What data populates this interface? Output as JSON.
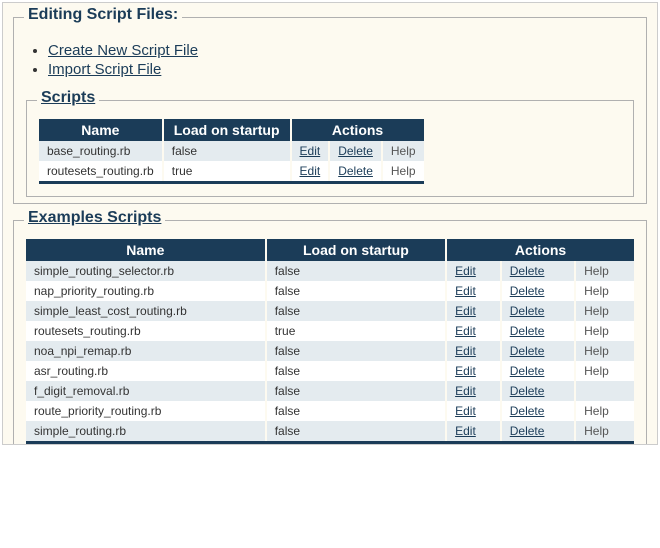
{
  "heading": "Editing Script Files:",
  "top_links": {
    "create": "Create New Script File",
    "import": "Import Script File"
  },
  "labels": {
    "edit": "Edit",
    "delete": "Delete",
    "help": "Help"
  },
  "scripts": {
    "title": "Scripts",
    "columns": {
      "name": "Name",
      "load": "Load on startup",
      "actions": "Actions"
    },
    "rows": [
      {
        "name": "base_routing.rb",
        "load": "false",
        "help": true
      },
      {
        "name": "routesets_routing.rb",
        "load": "true",
        "help": true
      }
    ]
  },
  "examples": {
    "title": "Examples Scripts",
    "columns": {
      "name": "Name",
      "load": "Load on startup",
      "actions": "Actions"
    },
    "rows": [
      {
        "name": "simple_routing_selector.rb",
        "load": "false",
        "help": true
      },
      {
        "name": "nap_priority_routing.rb",
        "load": "false",
        "help": true
      },
      {
        "name": "simple_least_cost_routing.rb",
        "load": "false",
        "help": true
      },
      {
        "name": "routesets_routing.rb",
        "load": "true",
        "help": true
      },
      {
        "name": "noa_npi_remap.rb",
        "load": "false",
        "help": true
      },
      {
        "name": "asr_routing.rb",
        "load": "false",
        "help": true
      },
      {
        "name": "f_digit_removal.rb",
        "load": "false",
        "help": false
      },
      {
        "name": "route_priority_routing.rb",
        "load": "false",
        "help": true
      },
      {
        "name": "simple_routing.rb",
        "load": "false",
        "help": true
      }
    ]
  }
}
